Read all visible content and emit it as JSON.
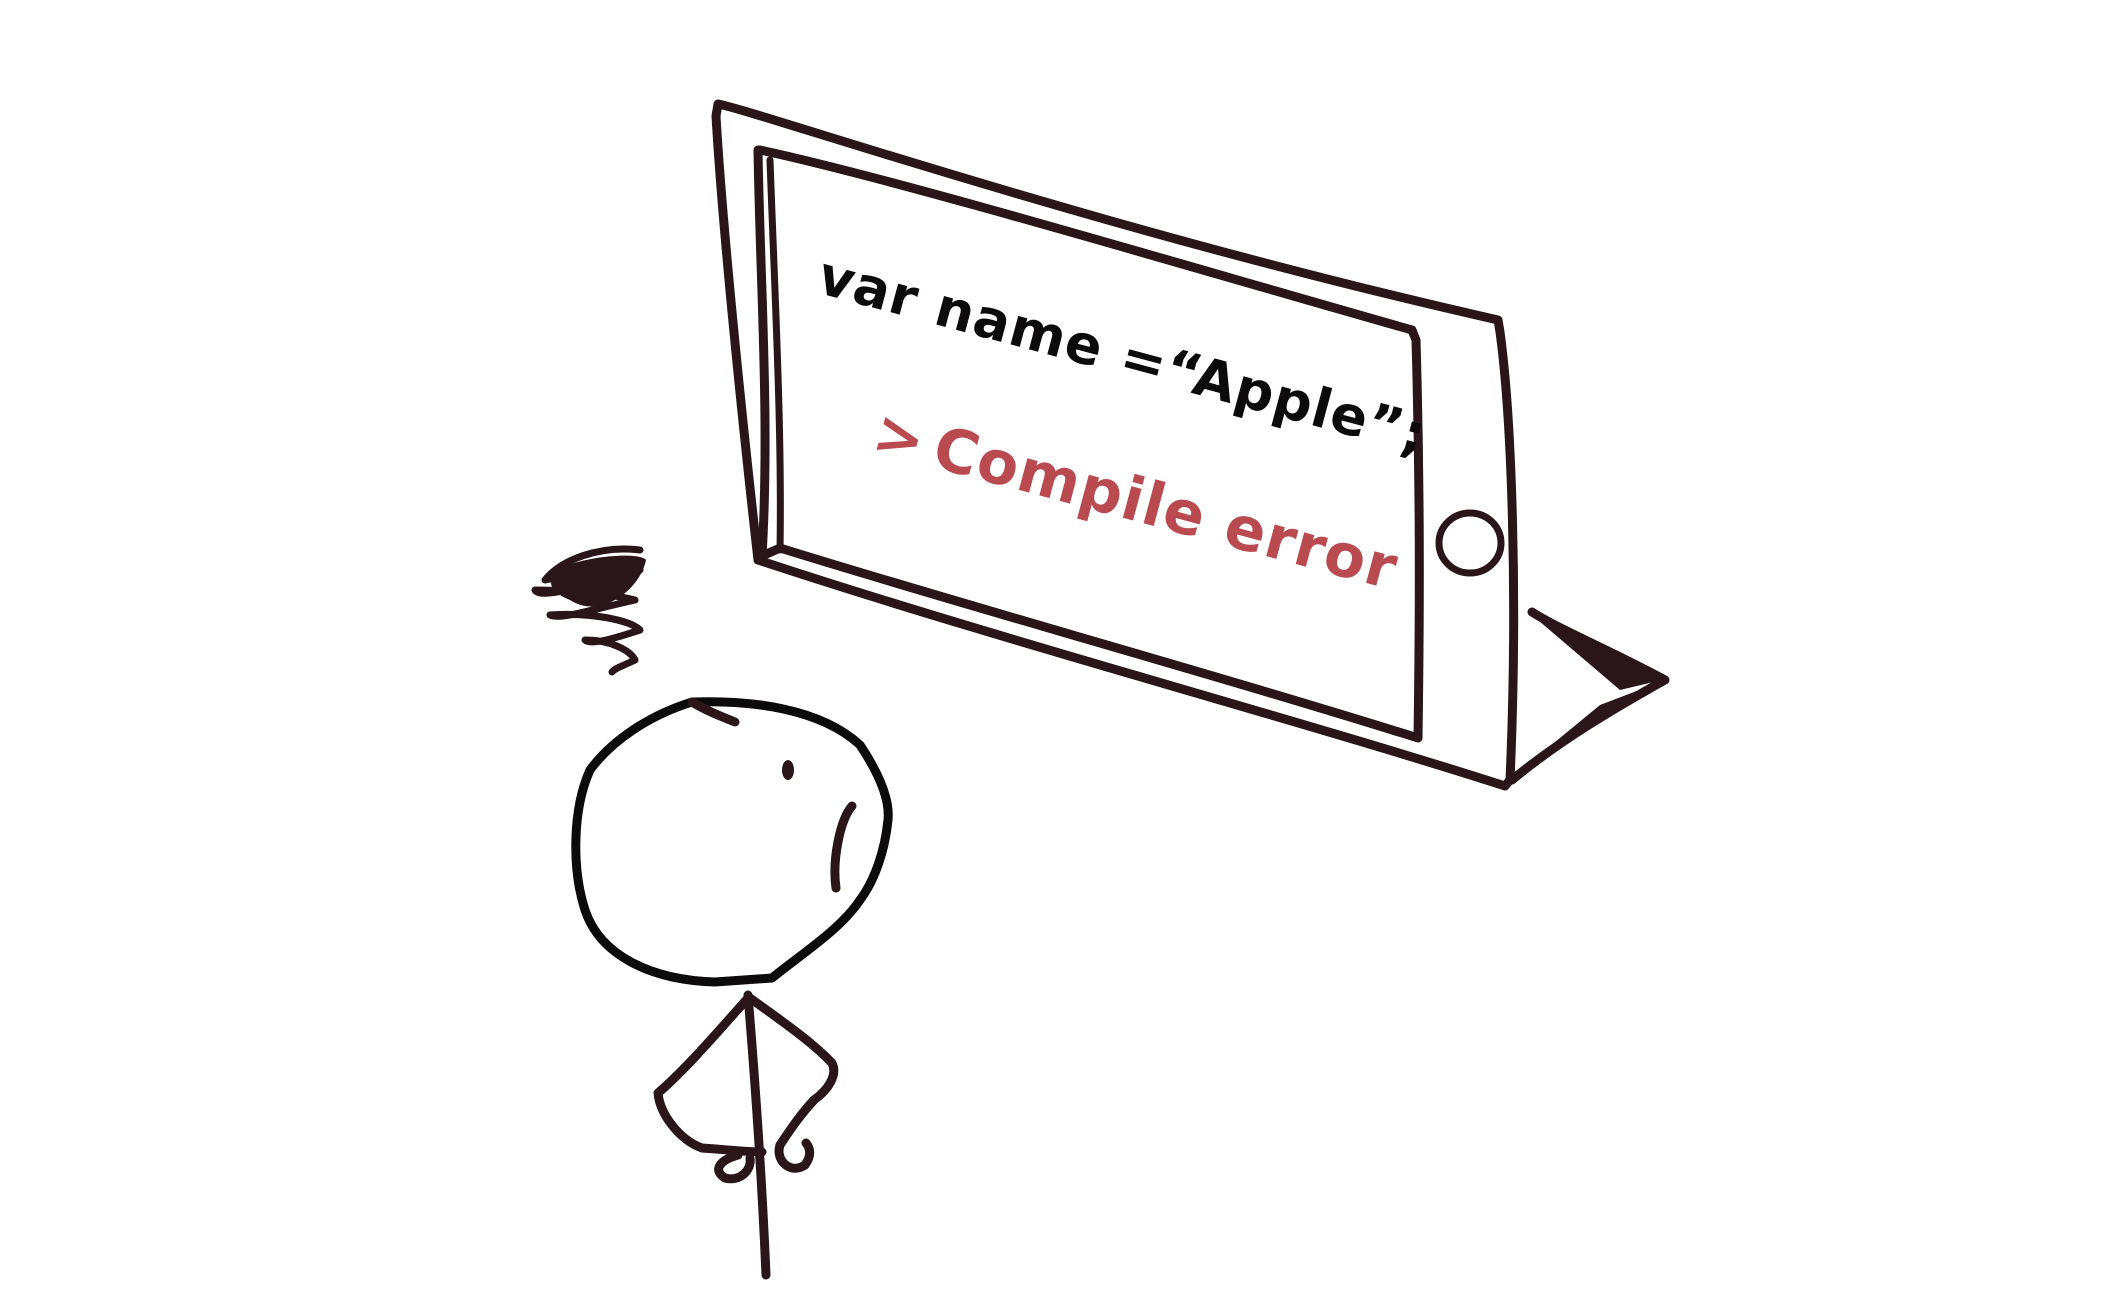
{
  "screen": {
    "code_line": "var name =“Apple”;",
    "error_prompt": ">",
    "error_message": "Compile error"
  },
  "colors": {
    "ink": "#2a1619",
    "code": "#0d0a0b",
    "error": "#b94a50",
    "background": "#ffffff"
  },
  "icons": {
    "home_button": "circle",
    "frustration_scribble": "scribble-cloud"
  }
}
